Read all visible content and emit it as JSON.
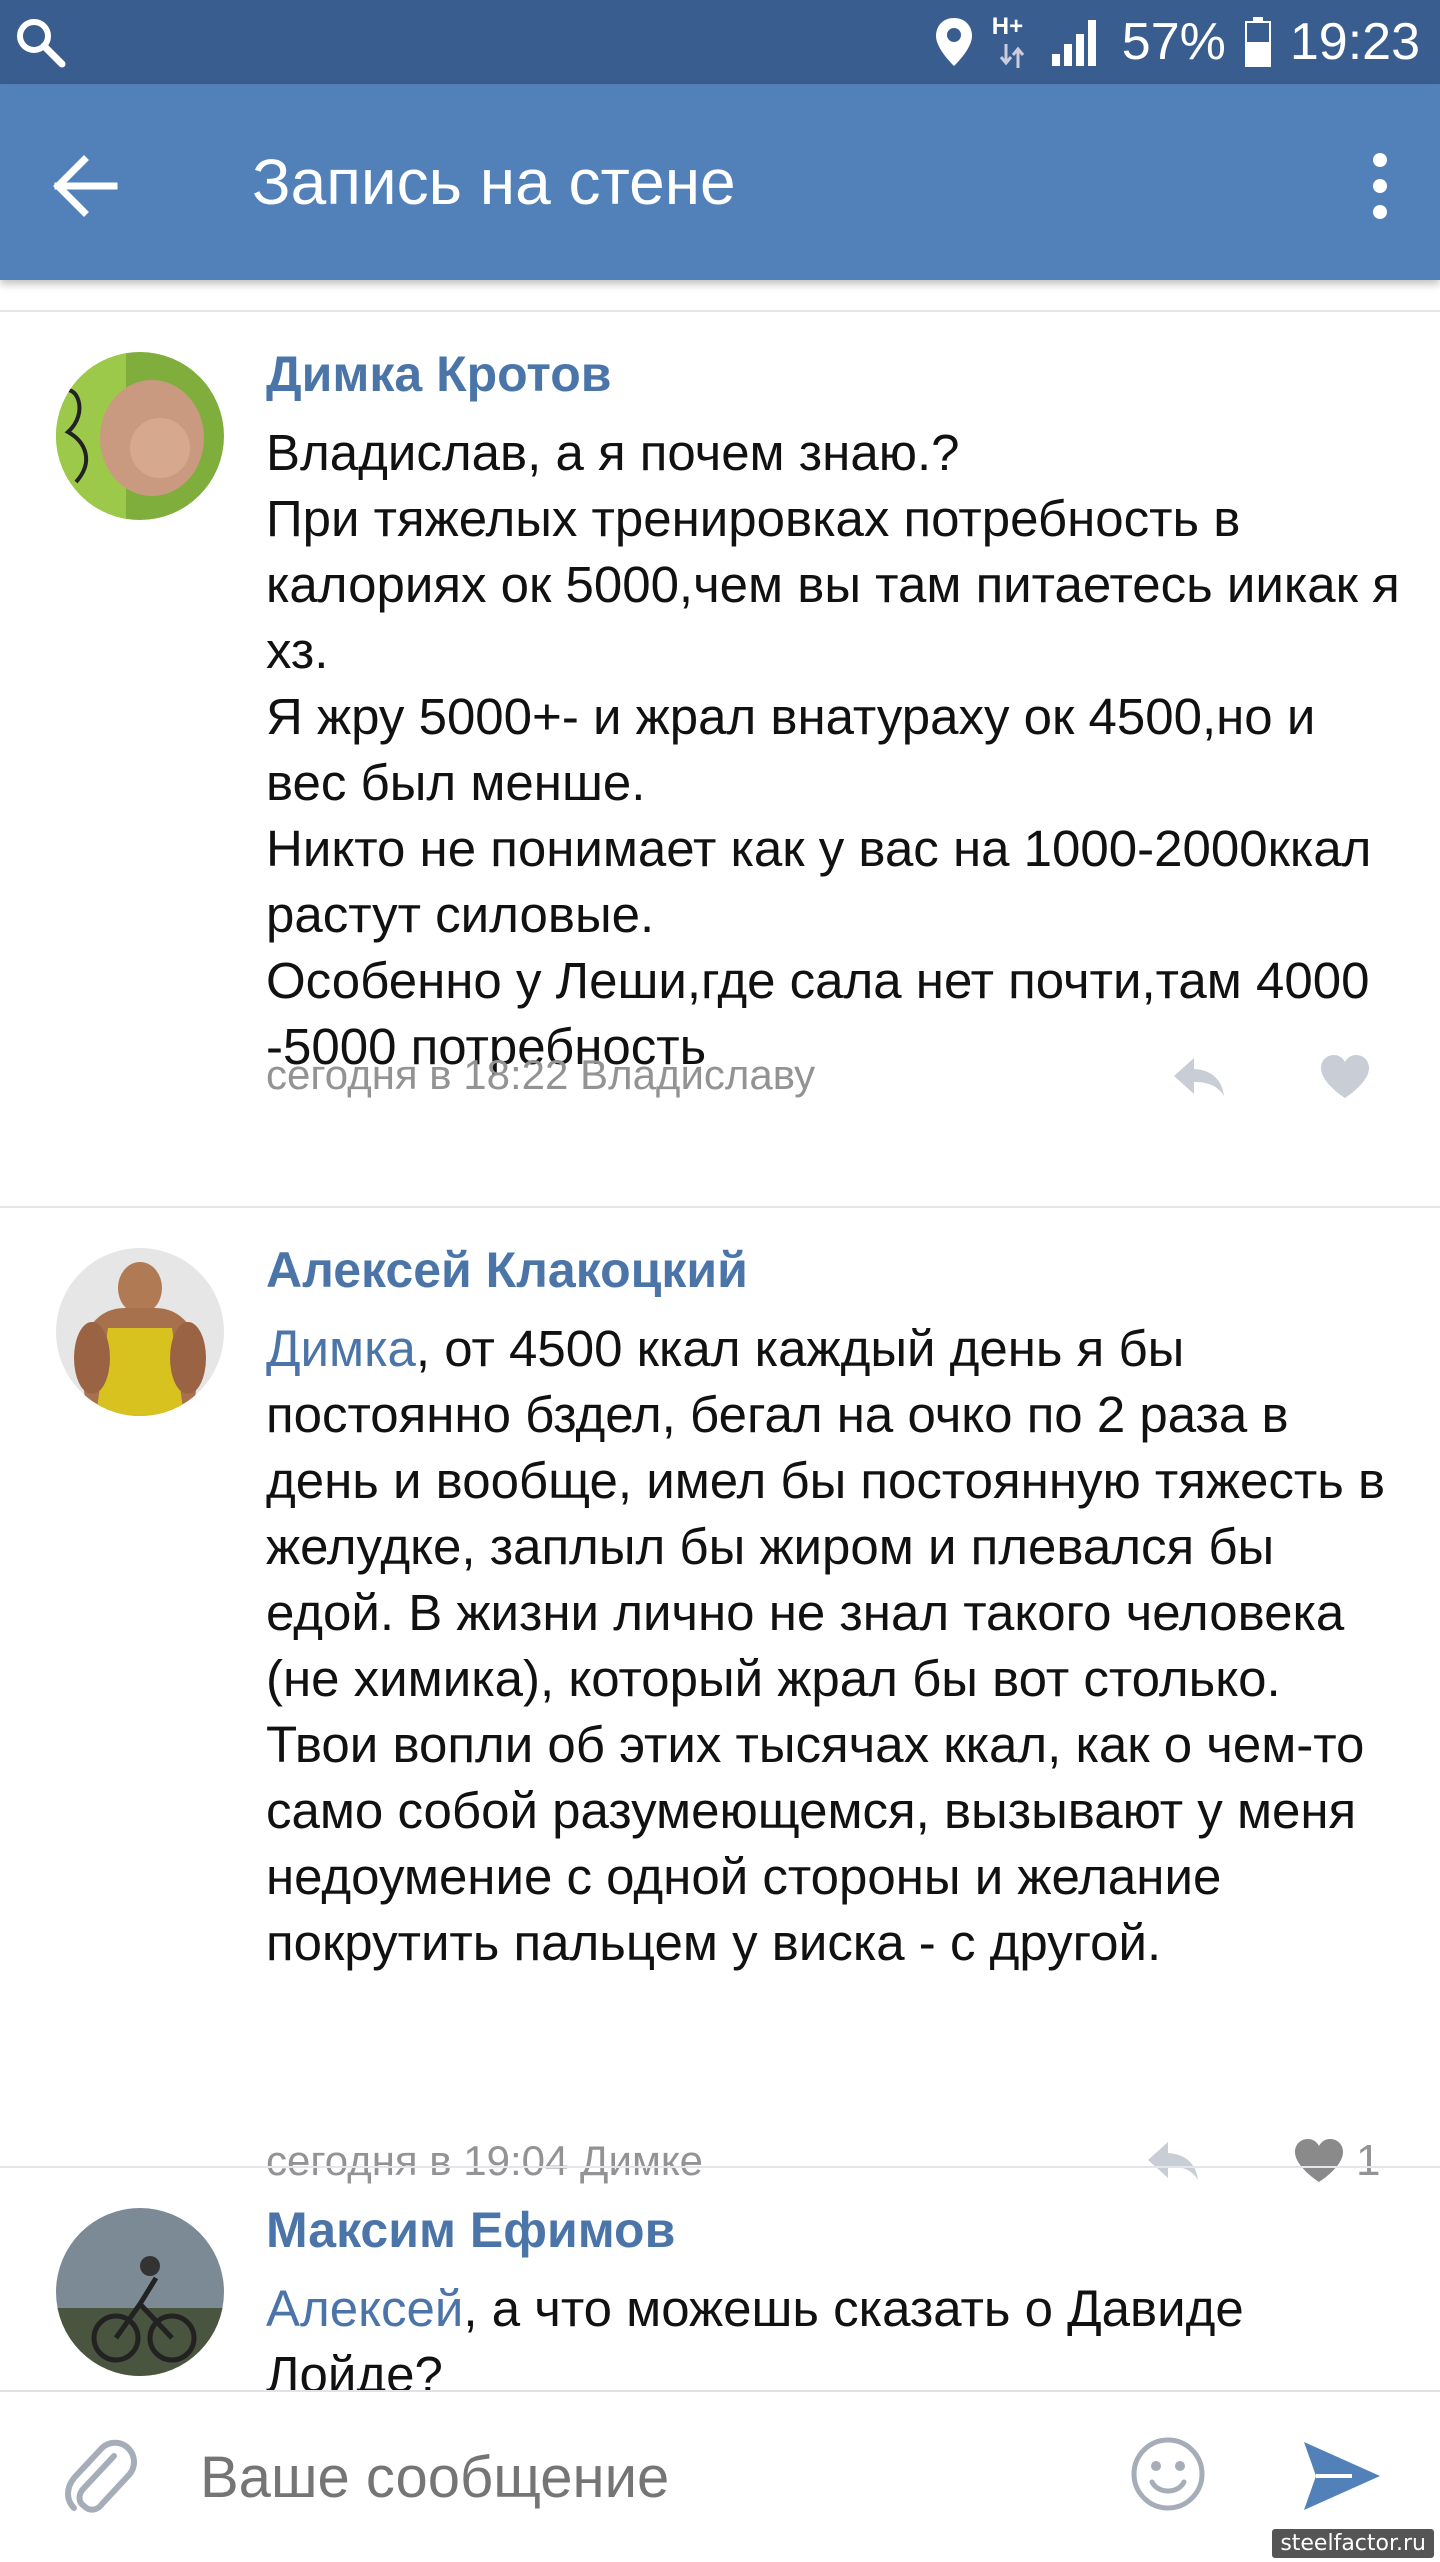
{
  "status_bar": {
    "network": "H+",
    "battery": "57%",
    "time": "19:23"
  },
  "toolbar": {
    "title": "Запись на стене"
  },
  "comments": [
    {
      "author": "Димка Кротов",
      "mention": "",
      "text": "Владислав, а я почем знаю.?\nПри тяжелых тренировках потребность в калориях ок 5000,чем вы там питаетесь иикак я хз.\nЯ жру 5000+- и жрал внатураху  ок 4500,но и вес был менше.\nНикто не понимает как у вас на 1000-2000ккал растут силовые.\nОсобенно у Леши,где сала нет почти,там 4000 -5000 потребность",
      "meta": "сегодня в 18:22 Владиславу",
      "likes": ""
    },
    {
      "author": "Алексей Клакоцкий",
      "mention": "Димка",
      "text": ", от 4500 ккал каждый день я бы постоянно бздел, бегал на очко по 2 раза в день и вообще, имел бы постоянную тяжесть в желудке, заплыл бы жиром и плевался бы едой. В жизни лично не знал такого человека (не химика), который жрал бы вот столько. Твои вопли об этих тысячах ккал, как о чем-то само собой разумеющемся, вызывают у меня недоумение с одной стороны и желание покрутить пальцем у виска - с другой.",
      "meta": "сегодня в 19:04 Димке",
      "likes": "1"
    },
    {
      "author": "Максим Ефимов",
      "mention": "Алексей",
      "text": ", а что можешь сказать о Давиде Лойде?",
      "meta": "",
      "likes": ""
    }
  ],
  "composer": {
    "placeholder": "Ваше сообщение"
  },
  "watermark": "steelfactor.ru",
  "colors": {
    "status_bar": "#3a5d8f",
    "toolbar": "#5181b8",
    "link": "#4b75a8",
    "meta": "#939393"
  },
  "icons": [
    "search-icon",
    "location-icon",
    "signal-icon",
    "battery-icon",
    "back-arrow-icon",
    "more-vert-icon",
    "reply-icon",
    "heart-icon",
    "attach-icon",
    "emoji-icon",
    "send-icon"
  ]
}
